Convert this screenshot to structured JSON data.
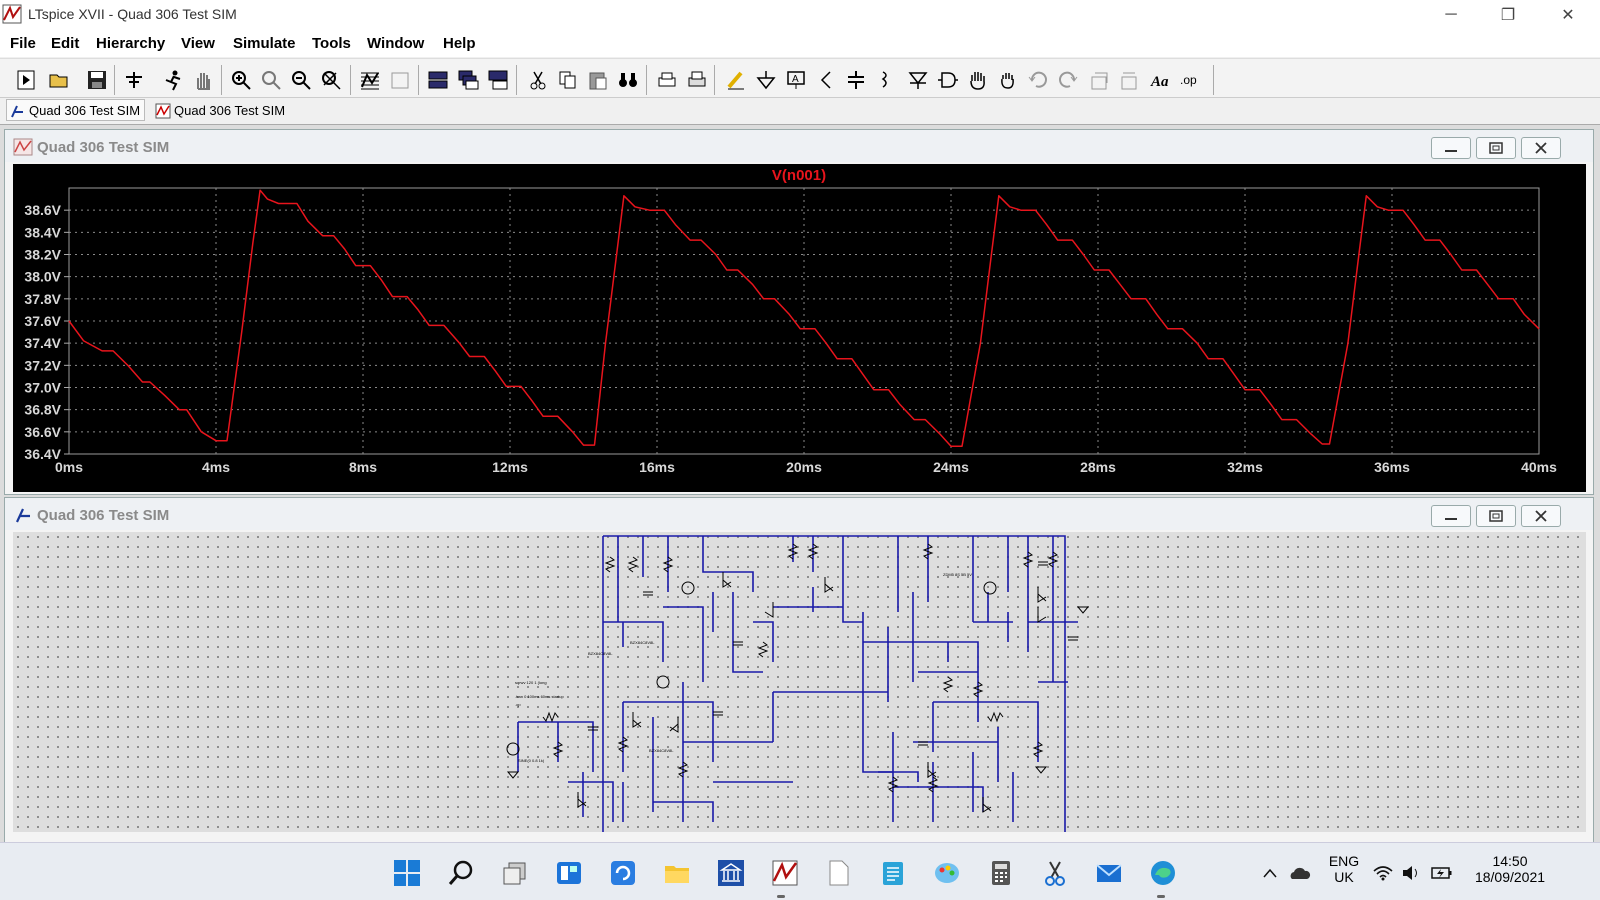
{
  "window": {
    "title": "LTspice XVII - Quad 306 Test SIM"
  },
  "menu": [
    "File",
    "Edit",
    "Hierarchy",
    "View",
    "Simulate",
    "Tools",
    "Window",
    "Help"
  ],
  "tabs": [
    {
      "label": "Quad 306 Test SIM",
      "icon": "schematic-icon",
      "active": true
    },
    {
      "label": "Quad 306 Test SIM",
      "icon": "waveform-icon",
      "active": false
    }
  ],
  "plot_window": {
    "title": "Quad 306 Test SIM"
  },
  "schematic_window": {
    "title": "Quad 306 Test SIM"
  },
  "chart_data": {
    "type": "line",
    "title": "V(n001)",
    "xlabel": "",
    "ylabel": "",
    "xlim": [
      0,
      40
    ],
    "ylim": [
      36.4,
      38.8
    ],
    "x_ticks": [
      "0ms",
      "4ms",
      "8ms",
      "12ms",
      "16ms",
      "20ms",
      "24ms",
      "28ms",
      "32ms",
      "36ms",
      "40ms"
    ],
    "y_ticks": [
      "36.4V",
      "36.6V",
      "36.8V",
      "37.0V",
      "37.2V",
      "37.4V",
      "37.6V",
      "37.8V",
      "38.0V",
      "38.2V",
      "38.4V",
      "38.6V"
    ],
    "grid": true,
    "series": [
      {
        "name": "V(n001)",
        "color": "#e8141c",
        "x": [
          0,
          0.4,
          0.9,
          1.2,
          1.6,
          2.0,
          2.2,
          2.6,
          3.0,
          3.2,
          3.6,
          4.0,
          4.3,
          4.7,
          5.0,
          5.2,
          5.4,
          5.7,
          6.2,
          6.5,
          6.9,
          7.2,
          7.5,
          7.8,
          8.2,
          8.5,
          8.8,
          9.2,
          9.5,
          9.8,
          10.2,
          10.6,
          10.9,
          11.3,
          11.6,
          11.9,
          12.3,
          12.6,
          12.9,
          13.3,
          13.7,
          14.0,
          14.3,
          14.6,
          14.9,
          15.1,
          15.4,
          15.8,
          16.2,
          16.5,
          16.9,
          17.2,
          17.6,
          17.9,
          18.2,
          18.6,
          18.9,
          19.2,
          19.6,
          19.9,
          20.3,
          20.6,
          20.9,
          21.3,
          21.6,
          21.9,
          22.3,
          22.6,
          23.0,
          23.3,
          23.7,
          24.0,
          24.3,
          24.8,
          25.1,
          25.3,
          25.6,
          25.9,
          26.3,
          26.6,
          26.9,
          27.3,
          27.6,
          27.9,
          28.3,
          28.6,
          28.9,
          29.3,
          29.6,
          29.9,
          30.3,
          30.7,
          31.0,
          31.4,
          31.7,
          32.0,
          32.4,
          32.7,
          33.0,
          33.4,
          33.8,
          34.1,
          34.3,
          34.8,
          35.1,
          35.3,
          35.6,
          35.9,
          36.3,
          36.6,
          36.9,
          37.3,
          37.6,
          37.9,
          38.3,
          38.6,
          38.9,
          39.3,
          39.6,
          40.0
        ],
        "y": [
          37.6,
          37.42,
          37.33,
          37.33,
          37.2,
          37.05,
          37.05,
          36.93,
          36.8,
          36.8,
          36.6,
          36.52,
          36.52,
          37.5,
          38.3,
          38.78,
          38.7,
          38.66,
          38.66,
          38.5,
          38.37,
          38.37,
          38.25,
          38.1,
          38.1,
          37.97,
          37.82,
          37.82,
          37.7,
          37.56,
          37.56,
          37.41,
          37.28,
          37.28,
          37.15,
          37.01,
          37.01,
          36.88,
          36.74,
          36.74,
          36.6,
          36.48,
          36.48,
          37.4,
          38.2,
          38.73,
          38.63,
          38.6,
          38.6,
          38.47,
          38.33,
          38.33,
          38.2,
          38.06,
          38.06,
          37.93,
          37.8,
          37.8,
          37.66,
          37.53,
          37.53,
          37.4,
          37.26,
          37.26,
          37.12,
          36.98,
          36.98,
          36.85,
          36.71,
          36.71,
          36.58,
          36.47,
          36.47,
          37.4,
          38.2,
          38.73,
          38.63,
          38.6,
          38.6,
          38.47,
          38.33,
          38.33,
          38.2,
          38.06,
          38.06,
          37.93,
          37.8,
          37.8,
          37.66,
          37.53,
          37.53,
          37.4,
          37.26,
          37.26,
          37.12,
          36.98,
          36.98,
          36.85,
          36.71,
          36.71,
          36.58,
          36.49,
          36.49,
          37.4,
          38.2,
          38.73,
          38.63,
          38.6,
          38.6,
          38.47,
          38.33,
          38.33,
          38.2,
          38.06,
          38.06,
          37.93,
          37.8,
          37.8,
          37.66,
          37.53
        ]
      }
    ]
  },
  "taskbar": {
    "apps": [
      "windows-start-icon",
      "search-icon",
      "task-view-icon",
      "widgets-icon",
      "refresh-app-icon",
      "file-explorer-icon",
      "bank-icon",
      "ltspice-icon",
      "document-icon",
      "notepad-icon",
      "paint-icon",
      "calculator-icon",
      "snipping-tool-icon",
      "mail-icon",
      "edge-icon"
    ],
    "lang_line1": "ENG",
    "lang_line2": "UK",
    "time": "14:50",
    "date": "18/09/2021"
  }
}
